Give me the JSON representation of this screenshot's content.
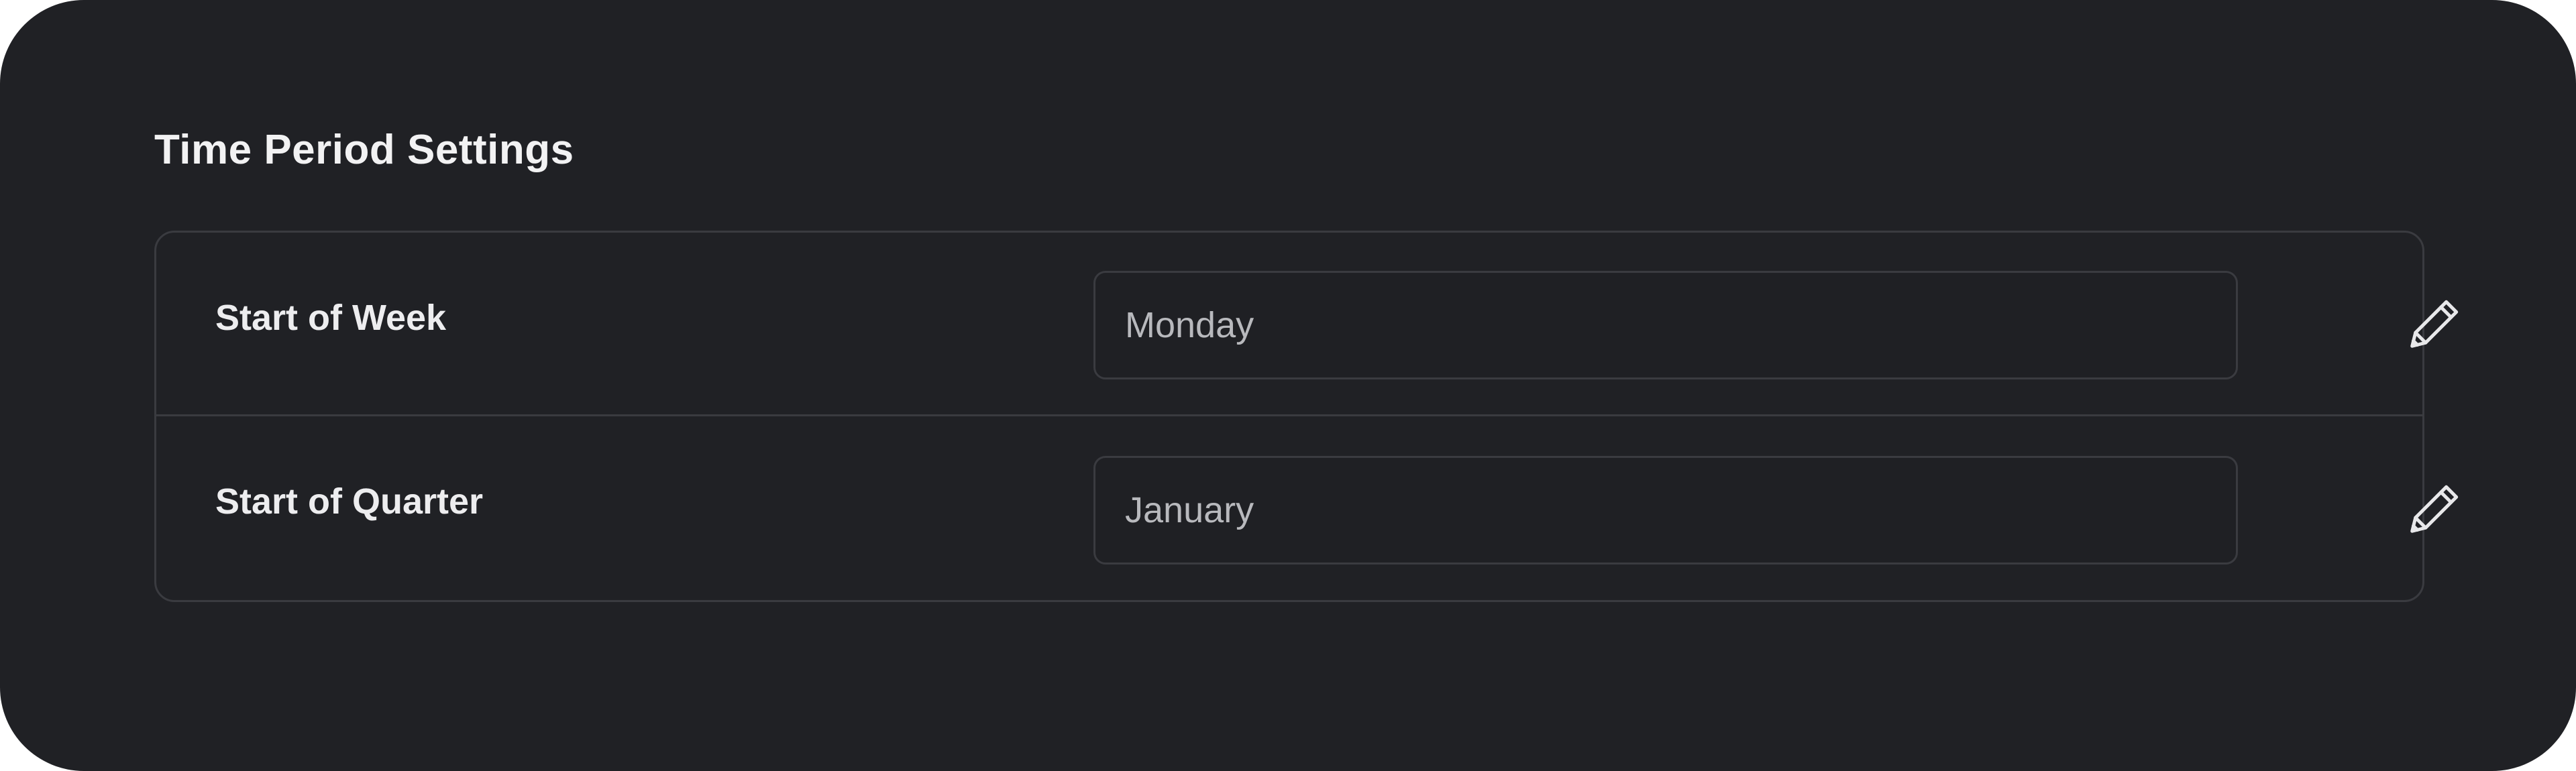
{
  "section": {
    "title": "Time Period Settings"
  },
  "settings": [
    {
      "label": "Start of Week",
      "value": "Monday",
      "action_icon": "pencil-icon"
    },
    {
      "label": "Start of Quarter",
      "value": "January",
      "action_icon": "pencil-icon"
    }
  ],
  "colors": {
    "background": "#202125",
    "border": "#3a3b40",
    "heading_text": "#f2f2f3",
    "value_text": "#b8b9bd"
  }
}
